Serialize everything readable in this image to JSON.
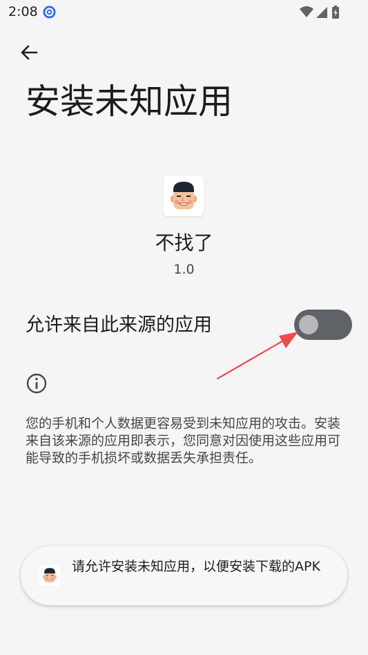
{
  "status_bar": {
    "time": "2:08",
    "app_icon": "notification-app-icon",
    "wifi_icon": "wifi-icon",
    "signal_icon": "signal-icon",
    "battery_icon": "battery-charging-icon"
  },
  "header": {
    "back_icon": "back-arrow-icon",
    "title": "安装未知应用"
  },
  "app": {
    "icon": "app-icon",
    "name": "不找了",
    "version": "1.0"
  },
  "setting": {
    "label": "允许来自此来源的应用",
    "enabled": false,
    "track_color": "#5f6368",
    "thumb_color": "#b8b8bc"
  },
  "annotation": {
    "arrow_color": "#ef4a4f"
  },
  "info": {
    "icon": "info-icon",
    "warning": "您的手机和个人数据更容易受到未知应用的攻击。安装来自该来源的应用即表示，您同意对因使用这些应用可能导致的手机损坏或数据丢失承担责任。"
  },
  "toast": {
    "icon": "app-icon",
    "message": "请允许安装未知应用，以便安装下载的APK"
  }
}
